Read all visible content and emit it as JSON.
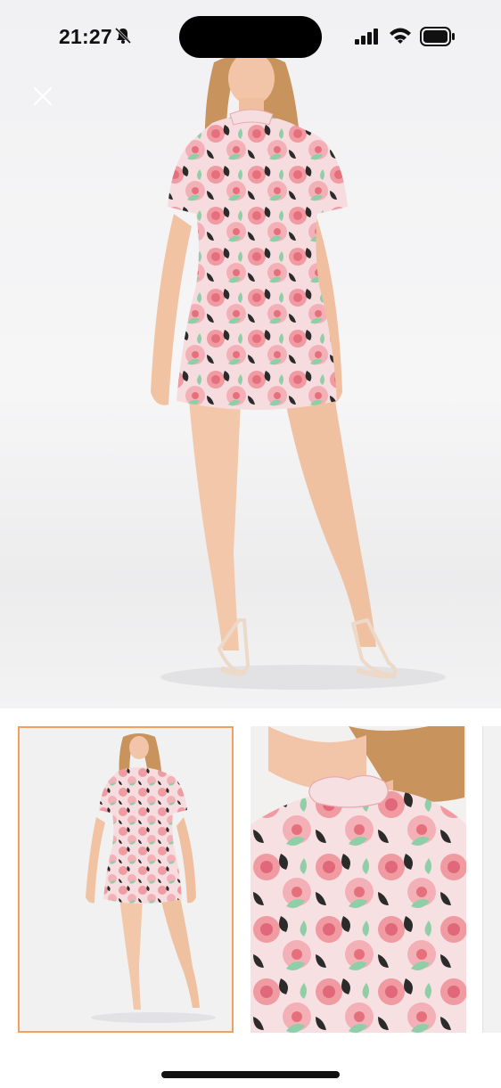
{
  "status_bar": {
    "time": "21:27",
    "icons": [
      "bell-slash-icon",
      "signal-icon",
      "wifi-icon",
      "battery-icon"
    ]
  },
  "viewer": {
    "close_icon": "close-icon",
    "main_image": "product-model-full-body",
    "thumbnails": [
      {
        "name": "thumbnail-full-body",
        "selected": true
      },
      {
        "name": "thumbnail-neckline-detail",
        "selected": false
      },
      {
        "name": "thumbnail-partial",
        "selected": false
      }
    ]
  },
  "colors": {
    "selected_border": "#f2a05d",
    "dress_pink": "#f2a9b0",
    "leaf_green": "#8fcfa8"
  }
}
